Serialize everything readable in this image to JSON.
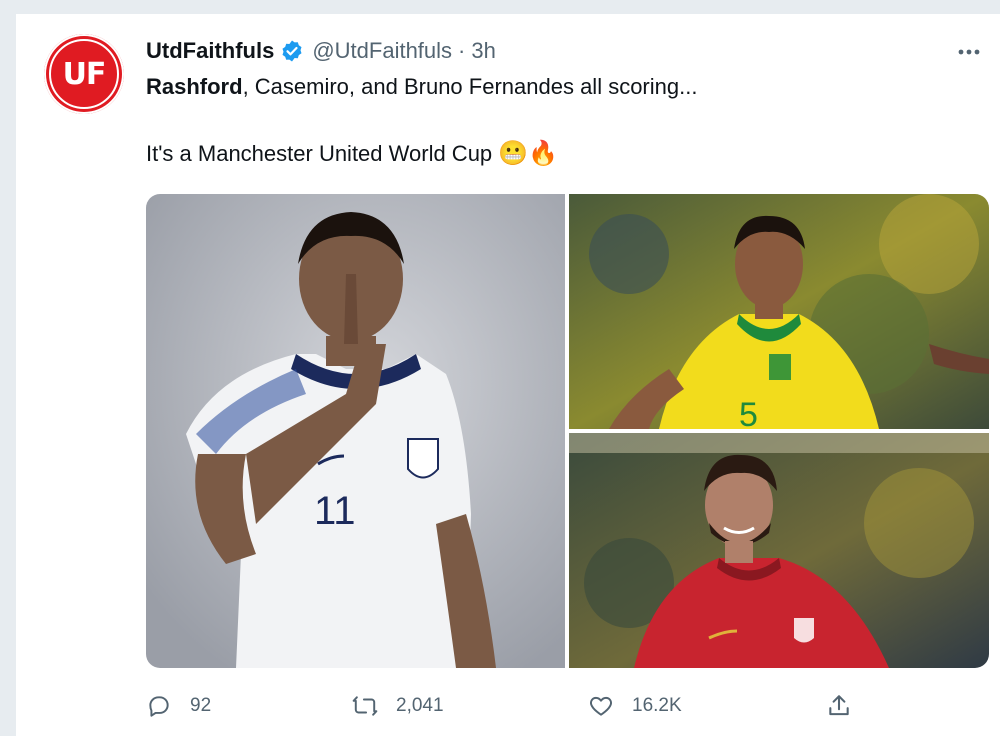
{
  "tweet": {
    "author": {
      "avatar_text": "UF",
      "display_name": "UtdFaithfuls",
      "handle": "@UtdFaithfuls",
      "separator": "·",
      "time": "3h",
      "verified": true
    },
    "more_icon": "more-horizontal-icon",
    "text": {
      "line1_bold": "Rashford",
      "line1_rest": ", Casemiro, and Bruno Fernandes all scoring...",
      "line2": "It's a Manchester United World Cup",
      "line2_emojis": "😬🔥"
    },
    "media": [
      {
        "subject": "england-player-photo"
      },
      {
        "subject": "brazil-player-photo"
      },
      {
        "subject": "portugal-player-photo"
      }
    ],
    "actions": {
      "replies": "92",
      "retweets": "2,041",
      "likes": "16.2K"
    }
  },
  "colors": {
    "accent_blue": "#1d9bf0",
    "text_primary": "#0f1419",
    "text_secondary": "#536471",
    "avatar_red": "#e01b22"
  }
}
